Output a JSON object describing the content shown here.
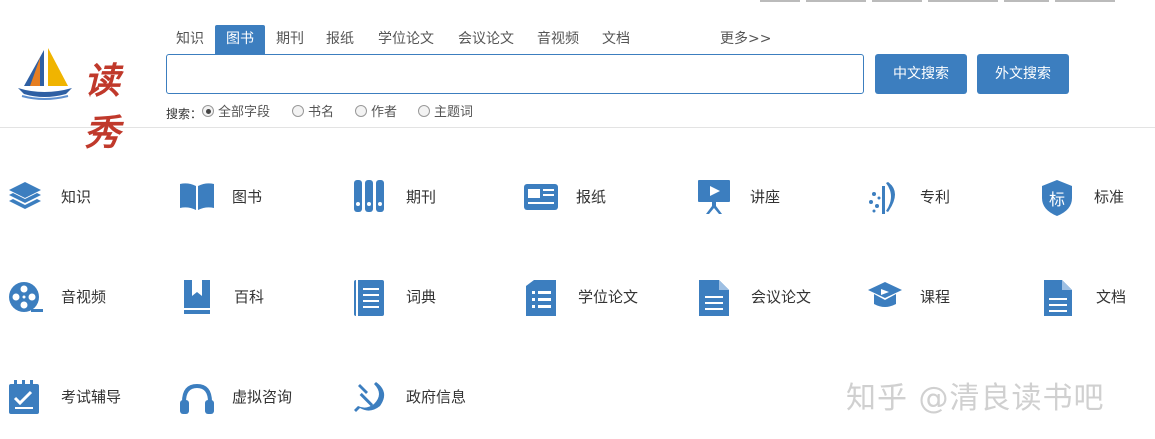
{
  "brand": {
    "logo_text": "读秀"
  },
  "tabs": [
    {
      "label": "知识",
      "active": false
    },
    {
      "label": "图书",
      "active": true
    },
    {
      "label": "期刊",
      "active": false
    },
    {
      "label": "报纸",
      "active": false
    },
    {
      "label": "学位论文",
      "active": false
    },
    {
      "label": "会议论文",
      "active": false
    },
    {
      "label": "音视频",
      "active": false
    },
    {
      "label": "文档",
      "active": false
    }
  ],
  "more_label": "更多>>",
  "search": {
    "value": "",
    "placeholder": ""
  },
  "buttons": {
    "chinese_search": "中文搜索",
    "foreign_search": "外文搜索"
  },
  "scope": {
    "label": "搜索：",
    "options": [
      {
        "label": "全部字段",
        "checked": true
      },
      {
        "label": "书名",
        "checked": false
      },
      {
        "label": "作者",
        "checked": false
      },
      {
        "label": "主题词",
        "checked": false
      }
    ]
  },
  "categories": [
    {
      "label": "知识",
      "icon": "layers-icon"
    },
    {
      "label": "图书",
      "icon": "open-book-icon"
    },
    {
      "label": "期刊",
      "icon": "binders-icon"
    },
    {
      "label": "报纸",
      "icon": "newspaper-icon"
    },
    {
      "label": "讲座",
      "icon": "presentation-icon"
    },
    {
      "label": "专利",
      "icon": "patent-icon"
    },
    {
      "label": "标准",
      "icon": "standard-shield-icon"
    },
    {
      "label": "音视频",
      "icon": "film-reel-icon"
    },
    {
      "label": "百科",
      "icon": "bookmark-book-icon"
    },
    {
      "label": "词典",
      "icon": "dictionary-icon"
    },
    {
      "label": "学位论文",
      "icon": "thesis-list-icon"
    },
    {
      "label": "会议论文",
      "icon": "document-lines-icon"
    },
    {
      "label": "课程",
      "icon": "graduation-cap-icon"
    },
    {
      "label": "文档",
      "icon": "file-icon"
    },
    {
      "label": "考试辅导",
      "icon": "exam-notepad-icon"
    },
    {
      "label": "虚拟咨询",
      "icon": "headphones-icon"
    },
    {
      "label": "政府信息",
      "icon": "hammer-sickle-icon"
    }
  ],
  "watermark": "知乎 @清良读书吧",
  "colors": {
    "accent": "#3c7ebf",
    "logo_red": "#c0392b"
  }
}
